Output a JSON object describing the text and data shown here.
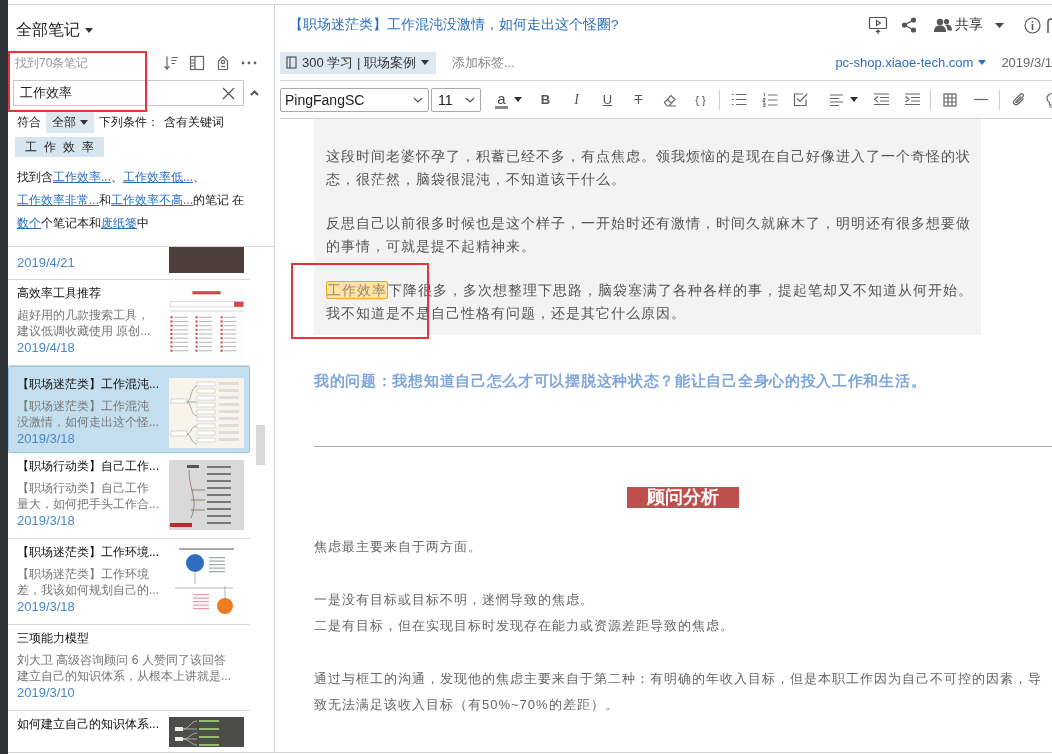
{
  "sidebar": {
    "title": "全部笔记",
    "result_count": "找到70条笔记",
    "search": {
      "value": "工作效率"
    },
    "filter": {
      "prefix": "符合",
      "match": "全部",
      "middle": "下列条件：",
      "condition": "含有关键词",
      "keyword": "工作效率"
    },
    "summary": [
      {
        "kind": "text",
        "text": "找到含"
      },
      {
        "kind": "link",
        "text": "工作效率..."
      },
      {
        "kind": "text",
        "text": "、"
      },
      {
        "kind": "link",
        "text": "工作效率低..."
      },
      {
        "kind": "text",
        "text": "、"
      },
      {
        "kind": "link",
        "text": "工作效率非常..."
      },
      {
        "kind": "text",
        "text": "和"
      },
      {
        "kind": "link",
        "text": "工作效率不高..."
      },
      {
        "kind": "text",
        "text": "的笔记 在"
      },
      {
        "kind": "link",
        "text": "数个"
      },
      {
        "kind": "text",
        "text": "个笔记本和"
      },
      {
        "kind": "link",
        "text": "废纸篓"
      },
      {
        "kind": "text",
        "text": "中"
      }
    ],
    "notes": [
      {
        "date": "2019/4/21",
        "thumbnail": {
          "kind": "photo"
        },
        "selected": false
      },
      {
        "title": "高效率工具推荐",
        "snippet": "超好用的几款搜索工具，建议低调收藏使用 原创...",
        "date": "2019/4/18",
        "thumbnail": {
          "kind": "webpage"
        },
        "selected": false
      },
      {
        "title": "【职场迷茫类】工作混沌...",
        "snippet": "【职场迷茫类】工作混沌没激情，如何走出这个怪...",
        "date": "2019/3/18",
        "thumbnail": {
          "kind": "mindmap"
        },
        "selected": true
      },
      {
        "title": "【职场行动类】自己工作...",
        "snippet": "【职场行动类】自己工作量大，如何把手头工作合...",
        "date": "2019/3/18",
        "thumbnail": {
          "kind": "mindmap-gray"
        },
        "selected": false
      },
      {
        "title": "【职场迷茫类】工作环境...",
        "snippet": "【职场迷茫类】工作环境差，我该如何规划自己的...",
        "date": "2019/3/18",
        "thumbnail": {
          "kind": "circles"
        },
        "selected": false
      },
      {
        "title": "三项能力模型",
        "snippet": "刘大卫 高级咨询顾问 6 人赞同了该回答建立自己的知识体系，从根本上讲就是...",
        "date": "2019/3/10",
        "selected": false
      },
      {
        "title": "如何建立自己的知识体系...",
        "thumbnail": {
          "kind": "mindmap-dark"
        },
        "selected": false
      }
    ]
  },
  "note": {
    "title": "【职场迷茫类】工作混沌没激情，如何走出这个怪圈?",
    "share_label": "共享",
    "notebook": "300 学习 | 职场案例",
    "tags": {
      "placeholder": "添加标签..."
    },
    "source": "pc-shop.xiaoe-tech.com",
    "date": "2019/3/1"
  },
  "toolbar": [
    {
      "kind": "font",
      "value": "PingFangSC"
    },
    {
      "kind": "size",
      "value": "11"
    },
    {
      "kind": "text-color",
      "label": "a"
    },
    {
      "kind": "bold",
      "label": "B"
    },
    {
      "kind": "italic",
      "label": "I"
    },
    {
      "kind": "underline",
      "label": "U"
    },
    {
      "kind": "strikethrough",
      "label": "T"
    },
    {
      "kind": "eraser"
    },
    {
      "kind": "code",
      "label": "{ }"
    },
    {
      "kind": "separator"
    },
    {
      "kind": "bullets"
    },
    {
      "kind": "numbered"
    },
    {
      "kind": "checklist"
    },
    {
      "kind": "align"
    },
    {
      "kind": "outdent"
    },
    {
      "kind": "indent"
    },
    {
      "kind": "separator"
    },
    {
      "kind": "table"
    },
    {
      "kind": "rule"
    },
    {
      "kind": "separator"
    },
    {
      "kind": "attach"
    },
    {
      "kind": "lamp"
    }
  ],
  "document": {
    "quote": [
      {
        "segments": [
          {
            "text": "这段时间老婆怀孕了，积蓄已经不多，有点焦虑。领我烦恼的是现在自己好像进入了一个奇怪的状态，很茫然，脑袋很混沌，不知道该干什么。",
            "highlighted": false
          }
        ]
      },
      {
        "segments": [
          {
            "text": "反思自己以前很多时候也是这个样子，一开始时还有激情，时间久就麻木了，明明还有很多想要做的事情，可就是提不起精神来。",
            "highlighted": false
          }
        ]
      },
      {
        "segments": [
          {
            "text": "工作效率",
            "highlighted": true
          },
          {
            "text": "下降很多，多次想整理下思路，脑袋塞满了各种各样的事，提起笔却又不知道从何开始。我不知道是不是自己性格有问题，还是其它什么原因。",
            "highlighted": false
          }
        ]
      }
    ],
    "question": "我的问题：我想知道自己怎么才可以摆脱这种状态？能让自己全身心的投入工作和生活。",
    "heading": "顾问分析",
    "analysis": [
      {
        "lines": [
          "焦虑最主要来自于两方面。"
        ]
      },
      {
        "lines": [
          "一是没有目标或目标不明，迷惘导致的焦虑。",
          "二是有目标，但在实现目标时发现存在能力或资源差距导致的焦虑。"
        ]
      },
      {
        "lines": [
          "通过与框工的沟通，发现他的焦虑主要来自于第二种：有明确的年收入目标，但是本职工作因为自己不可控的因素，导致无法满足该收入目标（有50%~70%的差距）。"
        ]
      }
    ]
  }
}
